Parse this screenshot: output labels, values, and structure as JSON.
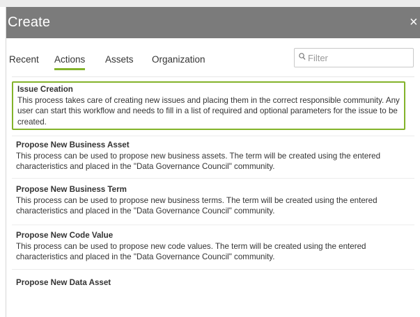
{
  "dialog": {
    "title": "Create",
    "close_symbol": "×",
    "close_icon": "close-icon"
  },
  "tabs": [
    {
      "label": "Recent",
      "active": false
    },
    {
      "label": "Actions",
      "active": true
    },
    {
      "label": "Assets",
      "active": false
    },
    {
      "label": "Organization",
      "active": false
    }
  ],
  "filter": {
    "placeholder": "Filter",
    "value": "",
    "icon": "search-icon"
  },
  "colors": {
    "header_bg": "#7b7b7b",
    "accent": "#83b32a",
    "text": "#333333"
  },
  "actions": [
    {
      "name": "Issue Creation",
      "description": "This process takes care of creating new issues and placing them in the correct responsible community. Any user can start this workflow and needs to fill in a list of required and optional parameters for the issue to be created.",
      "selected": true
    },
    {
      "name": "Propose New Business Asset",
      "description": "This process can be used to propose new business assets. The term will be created using the entered characteristics and placed in the \"Data Governance Council\" community.",
      "selected": false
    },
    {
      "name": "Propose New Business Term",
      "description": "This process can be used to propose new business terms. The term will be created using the entered characteristics and placed in the \"Data Governance Council\" community.",
      "selected": false
    },
    {
      "name": "Propose New Code Value",
      "description": "This process can be used to propose new code values. The term will be created using the entered characteristics and placed in the \"Data Governance Council\" community.",
      "selected": false
    },
    {
      "name": "Propose New Data Asset",
      "description": "",
      "selected": false
    }
  ]
}
